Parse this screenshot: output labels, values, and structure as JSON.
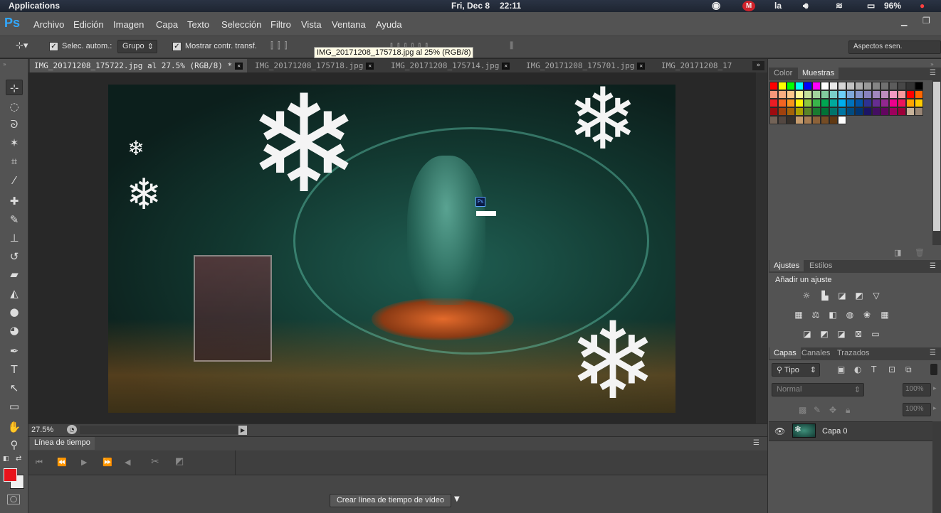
{
  "system_bar": {
    "app_label": "Applications",
    "date": "Fri, Dec 8",
    "time": "22:11",
    "lang": "la",
    "battery": "96%"
  },
  "menu": {
    "logo": "Ps",
    "items": [
      "Archivo",
      "Edición",
      "Imagen",
      "Capa",
      "Texto",
      "Selección",
      "Filtro",
      "Vista",
      "Ventana",
      "Ayuda"
    ]
  },
  "options": {
    "auto_select_label": "Selec. autom.:",
    "auto_select_value": "Grupo",
    "show_transform_label": "Mostrar contr. transf.",
    "workspace": "Aspectos esen.",
    "tooltip": "IMG_20171208_175718.jpg al 25% (RGB/8)"
  },
  "tabs": [
    {
      "label": "IMG_20171208_175722.jpg al 27.5% (RGB/8) *"
    },
    {
      "label": "IMG_20171208_175718.jpg"
    },
    {
      "label": "IMG_20171208_175714.jpg"
    },
    {
      "label": "IMG_20171208_175701.jpg"
    },
    {
      "label": "IMG_20171208_17"
    }
  ],
  "status": {
    "zoom": "27.5%"
  },
  "timeline": {
    "tab": "Línea de tiempo",
    "create_button": "Crear línea de tiempo de vídeo"
  },
  "swatches_panel": {
    "tabs": [
      "Color",
      "Muestras"
    ],
    "colors": [
      "#ff0000",
      "#ffff00",
      "#00ff00",
      "#00ffff",
      "#0000ff",
      "#ff00ff",
      "#ffffff",
      "#ebebeb",
      "#d6d6d6",
      "#c2c2c2",
      "#adadad",
      "#999999",
      "#858585",
      "#707070",
      "#5c5c5c",
      "#474747",
      "#333333",
      "#000000",
      "#f7977a",
      "#f9ad81",
      "#fdc68a",
      "#fff79a",
      "#c4df9b",
      "#a2d39c",
      "#82ca9d",
      "#7bcdc8",
      "#6ecff6",
      "#7ea7d8",
      "#8493ca",
      "#8882be",
      "#a187be",
      "#bc8dbf",
      "#f49ac2",
      "#f6989d",
      "#ff0000",
      "#ff6600",
      "#ed1c24",
      "#f26522",
      "#f7941d",
      "#fff200",
      "#8dc73f",
      "#39b54a",
      "#00a651",
      "#00a99d",
      "#00aeef",
      "#0072bc",
      "#0054a6",
      "#2e3192",
      "#662d91",
      "#92278f",
      "#ec008c",
      "#ed145b",
      "#ffa500",
      "#ffcc00",
      "#9e0b0f",
      "#a0410d",
      "#a36209",
      "#aba000",
      "#598527",
      "#1a7b30",
      "#007236",
      "#00746b",
      "#0076a3",
      "#004b80",
      "#003471",
      "#1b1464",
      "#440e62",
      "#630460",
      "#9e005d",
      "#9e0039",
      "#c7b299",
      "#998675",
      "#736357",
      "#534741",
      "#37302a",
      "#c69c6d",
      "#a67c52",
      "#8c6239",
      "#754c24",
      "#603913",
      "#ffffff"
    ],
    "empty_columns": 6
  },
  "adjustments_panel": {
    "tabs": [
      "Ajustes",
      "Estilos"
    ],
    "title": "Añadir un ajuste",
    "row1": [
      "brightness-icon",
      "levels-icon",
      "curves-icon",
      "exposure-icon",
      "vibrance-icon"
    ],
    "row2": [
      "hue-sat-icon",
      "color-balance-icon",
      "bw-icon",
      "photo-filter-icon",
      "channel-mixer-icon",
      "lookup-icon"
    ],
    "row3": [
      "invert-icon",
      "posterize-icon",
      "threshold-icon",
      "selective-color-icon",
      "gradient-map-icon"
    ]
  },
  "layers_panel": {
    "tabs": [
      "Capas",
      "Canales",
      "Trazados"
    ],
    "filter_label": "Tipo",
    "blend_mode": "Normal",
    "opacity": "100%",
    "fill": "100%",
    "layers": [
      {
        "name": "Capa 0",
        "visible": true
      }
    ]
  },
  "colors": {
    "foreground": "#e8131b",
    "background": "#f0f0f0",
    "accent": "#31a8ff"
  }
}
